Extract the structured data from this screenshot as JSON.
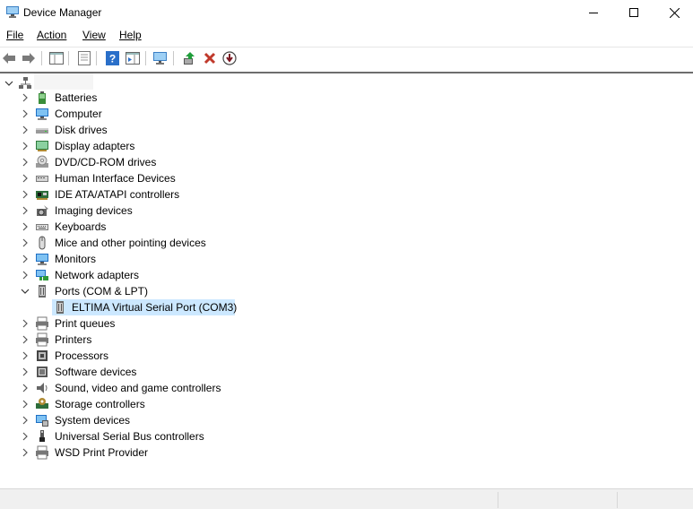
{
  "window": {
    "title": "Device Manager",
    "minimize_icon": "minimize-icon",
    "maximize_icon": "maximize-icon",
    "close_icon": "close-icon"
  },
  "menu": {
    "file": "File",
    "action": "Action",
    "view": "View",
    "help": "Help"
  },
  "toolbar": {
    "buttons": [
      "back-icon",
      "forward-icon",
      "show-hide-console-tree-icon",
      "properties-icon",
      "help-icon",
      "action-pane-icon",
      "scan-hardware-icon",
      "update-driver-icon",
      "uninstall-icon",
      "disable-device-icon"
    ]
  },
  "tree": {
    "root_label": "",
    "categories": [
      {
        "label": "Batteries",
        "icon": "battery-icon"
      },
      {
        "label": "Computer",
        "icon": "computer-icon"
      },
      {
        "label": "Disk drives",
        "icon": "disk-drive-icon"
      },
      {
        "label": "Display adapters",
        "icon": "display-adapter-icon"
      },
      {
        "label": "DVD/CD-ROM drives",
        "icon": "dvd-drive-icon"
      },
      {
        "label": "Human Interface Devices",
        "icon": "hid-icon"
      },
      {
        "label": "IDE ATA/ATAPI controllers",
        "icon": "ide-controller-icon"
      },
      {
        "label": "Imaging devices",
        "icon": "camera-icon"
      },
      {
        "label": "Keyboards",
        "icon": "keyboard-icon"
      },
      {
        "label": "Mice and other pointing devices",
        "icon": "mouse-icon"
      },
      {
        "label": "Monitors",
        "icon": "monitor-icon"
      },
      {
        "label": "Network adapters",
        "icon": "network-adapter-icon"
      },
      {
        "label": "Ports (COM & LPT)",
        "icon": "port-icon",
        "expanded": true
      },
      {
        "label": "Print queues",
        "icon": "print-queue-icon"
      },
      {
        "label": "Printers",
        "icon": "printer-icon"
      },
      {
        "label": "Processors",
        "icon": "processor-icon"
      },
      {
        "label": "Software devices",
        "icon": "software-device-icon"
      },
      {
        "label": "Sound, video and game controllers",
        "icon": "speaker-icon"
      },
      {
        "label": "Storage controllers",
        "icon": "storage-controller-icon"
      },
      {
        "label": "System devices",
        "icon": "system-device-icon"
      },
      {
        "label": "Universal Serial Bus controllers",
        "icon": "usb-icon"
      },
      {
        "label": "WSD Print Provider",
        "icon": "wsd-printer-icon"
      }
    ],
    "selected_child": {
      "label": "ELTIMA Virtual Serial Port (COM3)",
      "icon": "port-icon"
    }
  },
  "colors": {
    "selection": "#cce8ff",
    "status_bar": "#f0f0f0"
  }
}
